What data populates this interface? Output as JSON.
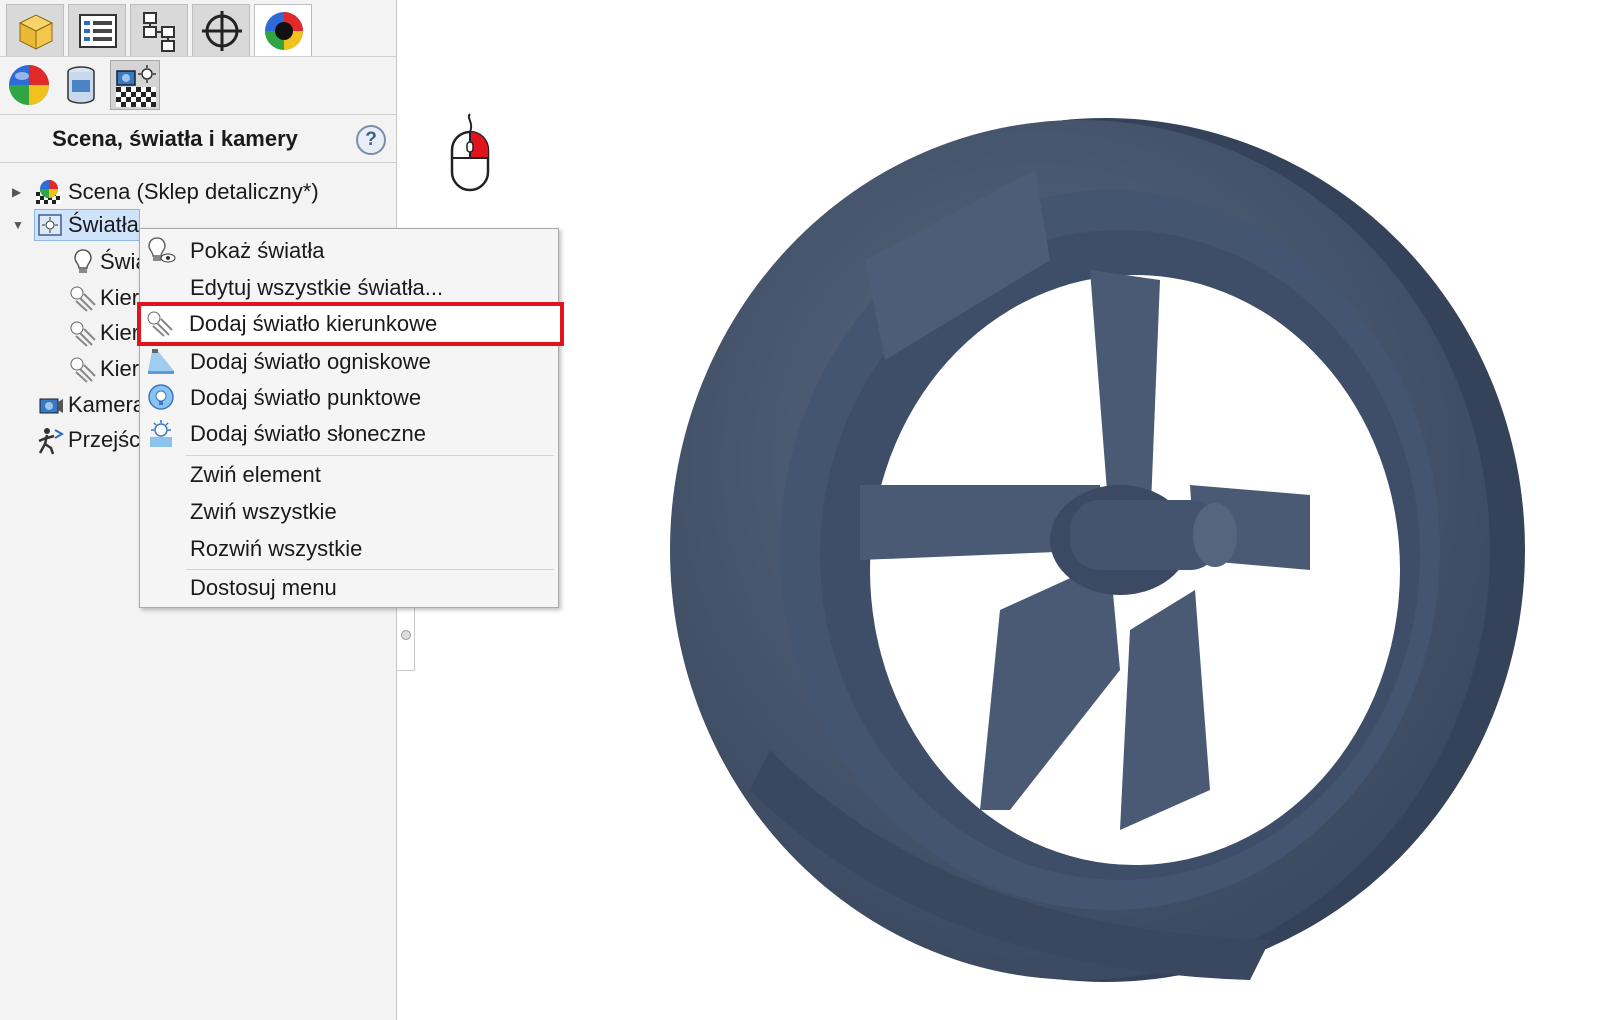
{
  "panel": {
    "title": "Scena, światła i kamery",
    "help_symbol": "?",
    "tabs": [
      {
        "icon": "part-icon"
      },
      {
        "icon": "property-manager-icon"
      },
      {
        "icon": "configuration-manager-icon"
      },
      {
        "icon": "dimxpert-icon"
      },
      {
        "icon": "display-manager-icon",
        "active": true
      }
    ],
    "subtabs": [
      {
        "icon": "appearances-icon"
      },
      {
        "icon": "decals-icon"
      },
      {
        "icon": "scene-lights-cameras-icon",
        "active": true
      }
    ],
    "tree": {
      "scene": "Scena (Sklep detaliczny*)",
      "lights": "Światła",
      "light_child_1": "Świa",
      "light_child_2": "Kier",
      "light_child_3": "Kier",
      "light_child_4": "Kier",
      "cameras": "Kamera",
      "walkthrough": "Przejśc"
    }
  },
  "context_menu": {
    "items": [
      {
        "label": "Pokaż światła",
        "icon": "show-lights-icon"
      },
      {
        "label": "Edytuj wszystkie światła...",
        "icon": ""
      },
      {
        "label": "Dodaj światło kierunkowe",
        "icon": "directional-light-icon",
        "highlighted": true
      },
      {
        "label": "Dodaj światło ogniskowe",
        "icon": "spot-light-icon"
      },
      {
        "label": "Dodaj światło punktowe",
        "icon": "point-light-icon"
      },
      {
        "label": "Dodaj światło słoneczne",
        "icon": "sun-light-icon"
      },
      {
        "label": "Zwiń element",
        "icon": ""
      },
      {
        "label": "Zwiń wszystkie",
        "icon": ""
      },
      {
        "label": "Rozwiń wszystkie",
        "icon": ""
      },
      {
        "label": "Dostosuj menu",
        "icon": ""
      }
    ]
  },
  "colors": {
    "highlight": "#e0141c",
    "model": "#4a5a70",
    "selection": "#cfe3fb"
  }
}
